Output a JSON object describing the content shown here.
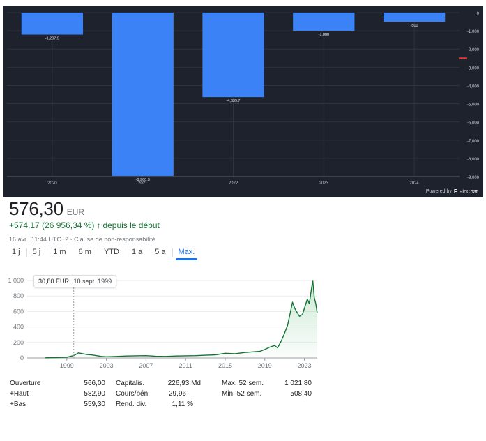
{
  "finchat_panel": {
    "brand_prefix": "Powered by",
    "brand_name": "FinChat",
    "bar_color": "#3b82f6",
    "background_color": "#1e222d",
    "marker_color": "#e53935"
  },
  "quote": {
    "price": "576,30",
    "currency": "EUR",
    "change": "+574,17 (26 956,34 %)",
    "change_arrow": "↑",
    "change_period": "depuis le début",
    "timestamp": "16 avr., 11:44 UTC+2",
    "separator": "·",
    "disclaimer": "Clause de non-responsabilité",
    "positive_color": "#137333"
  },
  "ranges": {
    "tabs": [
      "1 j",
      "5 j",
      "1 m",
      "6 m",
      "YTD",
      "1 a",
      "5 a",
      "Max."
    ],
    "selected": "Max."
  },
  "tooltip": {
    "value": "30,80 EUR",
    "date": "10 sept. 1999"
  },
  "stats": {
    "rows": [
      [
        {
          "label": "Ouverture",
          "value": "566,00"
        },
        {
          "label": "Capitalis.",
          "value": "226,93 Md"
        },
        {
          "label": "Max. 52 sem.",
          "value": "1 021,80"
        }
      ],
      [
        {
          "label": "+Haut",
          "value": "582,90"
        },
        {
          "label": "Cours/bén.",
          "value": "29,96"
        },
        {
          "label": "Min. 52 sem.",
          "value": "508,40"
        }
      ],
      [
        {
          "label": "+Bas",
          "value": "559,30"
        },
        {
          "label": "Rend. div.",
          "value": "1,11 %"
        },
        {
          "label": "",
          "value": ""
        }
      ]
    ]
  },
  "chart_data": [
    {
      "type": "bar",
      "categories": [
        "2020",
        "2021",
        "2022",
        "2023",
        "2024"
      ],
      "values": [
        -1207.5,
        -8960.3,
        -4639.7,
        -1000,
        -500
      ],
      "value_labels": [
        "-1,207.5",
        "-8,960.3",
        "-4,639.7",
        "-1,000",
        "-500"
      ],
      "ylim": [
        -9000,
        0
      ],
      "yticks": [
        0,
        -1000,
        -2000,
        -3000,
        -4000,
        -5000,
        -6000,
        -7000,
        -8000,
        -9000
      ],
      "ytick_labels": [
        "0",
        "-1,000",
        "-2,000",
        "-3,000",
        "-4,000",
        "-5,000",
        "-6,000",
        "-7,000",
        "-8,000",
        "-9,000"
      ],
      "marker_value": -2500,
      "grid": true
    },
    {
      "type": "area",
      "xlim": [
        1995,
        2024.3
      ],
      "ylim": [
        0,
        1000
      ],
      "xticks": [
        1999,
        2003,
        2007,
        2011,
        2015,
        2019,
        2023
      ],
      "yticks": [
        0,
        200,
        400,
        600,
        800,
        1000
      ],
      "ytick_labels": [
        "0",
        "200",
        "400",
        "600",
        "800",
        "1 000"
      ],
      "x": [
        1996.8,
        1998.0,
        1999.0,
        1999.7,
        2000.2,
        2000.6,
        2001.0,
        2001.5,
        2002.0,
        2002.5,
        2003.0,
        2004.0,
        2005.0,
        2006.0,
        2007.0,
        2008.0,
        2009.0,
        2010.0,
        2011.0,
        2012.0,
        2013.0,
        2014.0,
        2015.0,
        2016.0,
        2017.0,
        2018.0,
        2018.5,
        2019.0,
        2019.5,
        2020.0,
        2020.3,
        2020.7,
        2021.0,
        2021.3,
        2021.6,
        2021.8,
        2022.0,
        2022.2,
        2022.5,
        2022.8,
        2023.0,
        2023.3,
        2023.5,
        2023.7,
        2023.85,
        2024.0,
        2024.15,
        2024.3
      ],
      "y": [
        2,
        5,
        10,
        30.8,
        65,
        55,
        45,
        40,
        30,
        20,
        15,
        20,
        25,
        28,
        30,
        22,
        20,
        25,
        28,
        30,
        35,
        40,
        60,
        55,
        70,
        80,
        85,
        110,
        140,
        160,
        130,
        230,
        320,
        420,
        600,
        720,
        650,
        600,
        540,
        560,
        640,
        760,
        700,
        880,
        1000,
        780,
        700,
        576.3
      ],
      "grid": true
    }
  ]
}
